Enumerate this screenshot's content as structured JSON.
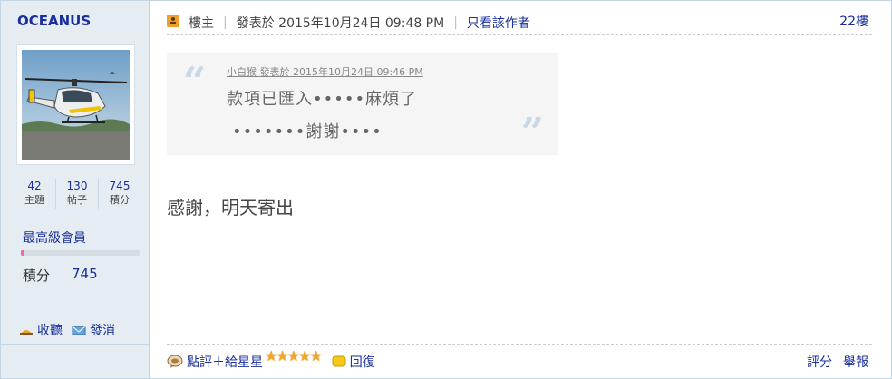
{
  "user": {
    "name": "OCEANUS",
    "stats": [
      {
        "value": "42",
        "label": "主題"
      },
      {
        "value": "130",
        "label": "帖子"
      },
      {
        "value": "745",
        "label": "積分"
      }
    ],
    "level": "最高級會員",
    "level_progress": 0.02,
    "points_label": "積分",
    "points_value": "745",
    "collect_label": "收聽",
    "message_label": "發消"
  },
  "post": {
    "owner_label": "樓主",
    "posted": "發表於 2015年10月24日 09:48 PM",
    "only_author": "只看該作者",
    "floor": "22樓",
    "quote_meta": "小白猴 發表於 2015年10月24日 09:46 PM",
    "quote_line1": "款項已匯入•••••麻煩了",
    "quote_line2": "•••••••謝謝••••",
    "message": "感謝，明天寄出",
    "rate_label": "點評＋給星星",
    "stars": 5,
    "reply_label": "回復",
    "score_label": "評分",
    "report_label": "舉報"
  },
  "colors": {
    "accent": "#1b2f9a",
    "sidebar_bg": "#e5edf2",
    "quote_bg": "#f5f5f5",
    "owner_icon": "#f0a02a",
    "star": "#f4a623",
    "level_fill": "#e96aa8"
  }
}
